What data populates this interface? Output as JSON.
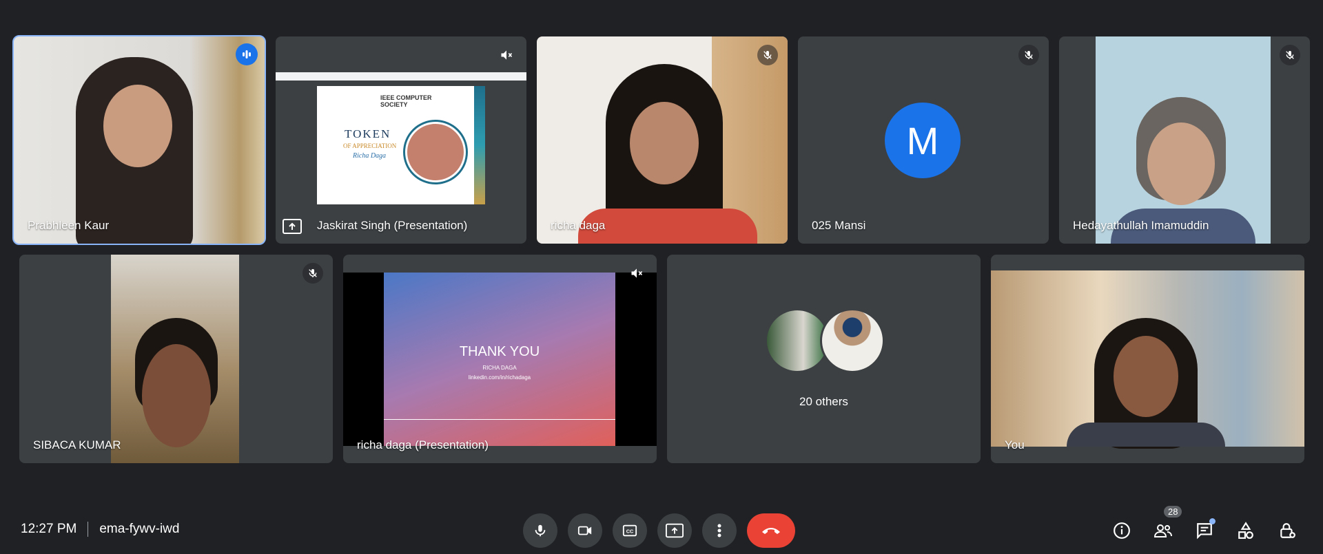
{
  "participants": {
    "p1": {
      "name": "Prabhleen Kaur"
    },
    "p2": {
      "name": "Jaskirat Singh (Presentation)"
    },
    "p3": {
      "name": "richa daga"
    },
    "p4": {
      "name": "025 Mansi",
      "initial": "M"
    },
    "p5": {
      "name": "Hedayathullah Imamuddin"
    },
    "p6": {
      "name": "SIBACA KUMAR"
    },
    "p7": {
      "name": "richa daga (Presentation)"
    },
    "p8": {
      "others_label": "20 others"
    },
    "p9": {
      "name": "You"
    }
  },
  "slide1": {
    "logo_text": "IEEE COMPUTER SOCIETY",
    "title": "TOKEN",
    "subtitle": "OF APPRECIATION",
    "person": "Richa Daga"
  },
  "slide2": {
    "title": "THANK YOU",
    "name": "RICHA DAGA",
    "link": "linkedin.com/in/richadaga"
  },
  "footer": {
    "time": "12:27 PM",
    "meeting_code": "ema-fywv-iwd",
    "people_count": "28"
  },
  "icons": {
    "mic": "mic-icon",
    "camera": "camera-icon",
    "captions": "captions-icon",
    "present": "present-icon",
    "more": "more-vert-icon",
    "end": "end-call-icon",
    "info": "info-icon",
    "people": "people-icon",
    "chat": "chat-icon",
    "activities": "activities-icon",
    "host": "host-controls-icon"
  },
  "colors": {
    "background": "#202124",
    "tile": "#3c4043",
    "accent": "#8ab4f8",
    "end_call": "#ea4335",
    "avatar": "#1a73e8"
  }
}
